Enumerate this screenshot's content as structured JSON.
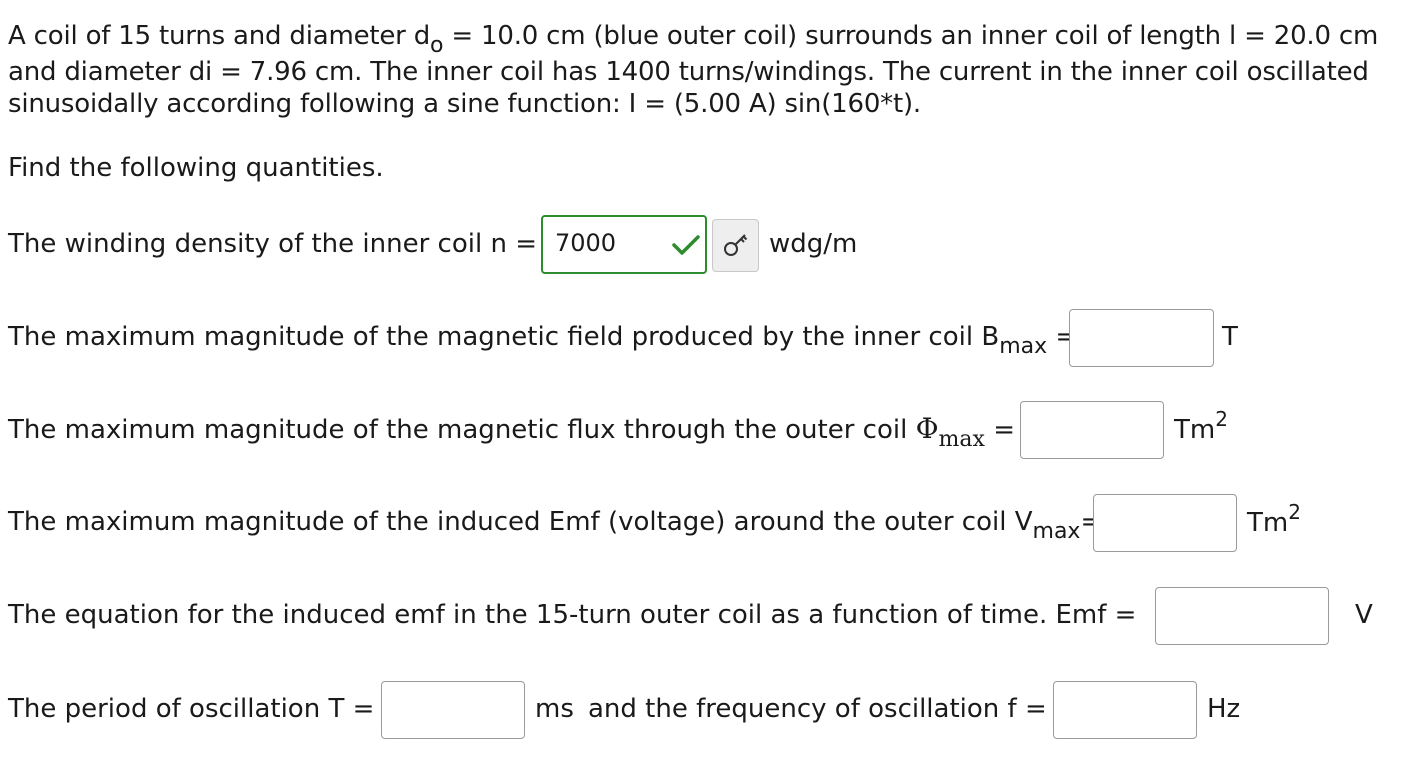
{
  "problem": {
    "line1_a": "A coil of 15 turns and diameter d",
    "line1_sub": "o",
    "line1_b": " = 10.0 cm (blue outer coil) surrounds an inner coil of length l = 20.0 cm",
    "line2": "and diameter di = 7.96 cm.  The inner coil has 1400 turns/windings. The current in the inner coil oscillated",
    "line3": "sinusoidally according following a sine function: I = (5.00 A) sin(160*t)."
  },
  "instruction": "Find the following quantities.",
  "questions": {
    "winding_density": {
      "label": "The winding density of the inner coil n =",
      "value": "7000",
      "unit": "wdg/m",
      "status": "correct",
      "check_icon": "check-icon",
      "key_icon": "key-icon"
    },
    "bmax": {
      "label": "The maximum magnitude of the magnetic field produced by the inner coil B",
      "sub": "max",
      "equals": "=",
      "value": "",
      "unit": "T"
    },
    "phimax": {
      "label": "The maximum magnitude of the magnetic flux through the outer coil",
      "symbol": "Φ",
      "sub": "max",
      "equals": "=",
      "value": "",
      "unit_base": "Tm",
      "unit_exp": "2"
    },
    "vmax": {
      "label": "The maximum magnitude of the induced Emf (voltage) around the outer coil V",
      "sub": "max",
      "equals": "=",
      "value": "",
      "unit_base": "Tm",
      "unit_exp": "2"
    },
    "emf": {
      "label": "The equation for the induced emf in the 15-turn outer coil as a function of time.  Emf =",
      "value": "",
      "unit": "V"
    },
    "period": {
      "label": "The period of oscillation T =",
      "value": "",
      "unit": "ms"
    },
    "frequency": {
      "label": "and the frequency of oscillation f =",
      "value": "",
      "unit": "Hz"
    }
  },
  "colors": {
    "correct_border": "#2e8b2e",
    "input_border": "#9a9a9a",
    "text": "#1a1a1a"
  }
}
